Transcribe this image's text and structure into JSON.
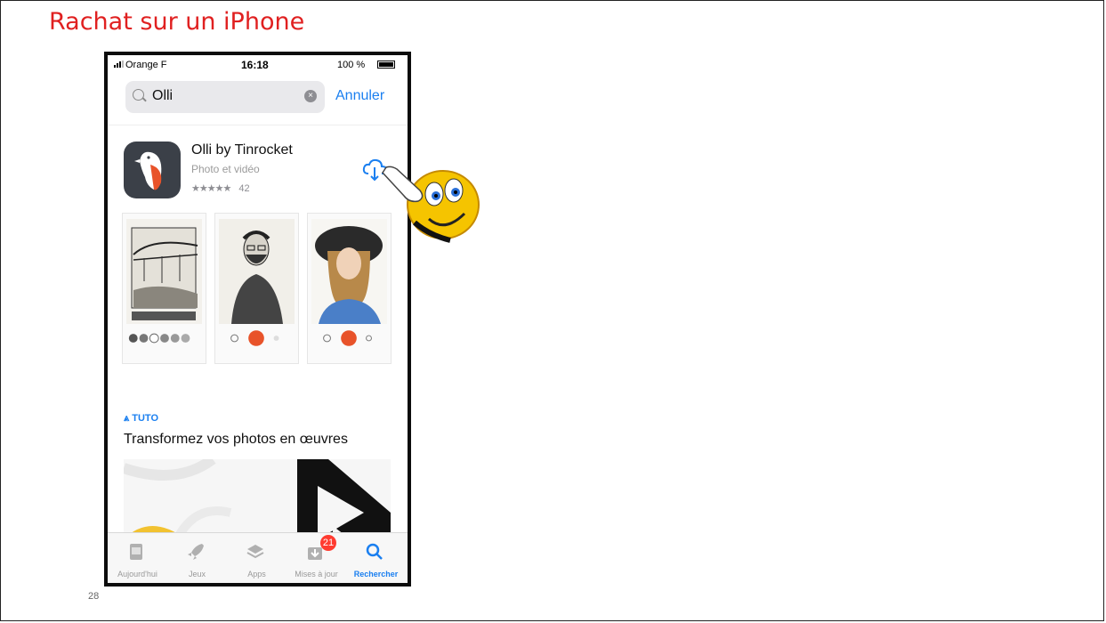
{
  "slide": {
    "title": "Rachat sur un iPhone",
    "number": "28"
  },
  "status_bar": {
    "carrier": "Orange F",
    "time": "16:18",
    "battery": "100 %"
  },
  "search": {
    "query": "Olli",
    "clear_symbol": "×",
    "cancel_label": "Annuler"
  },
  "app": {
    "name": "Olli by Tinrocket",
    "category": "Photo et vidéo",
    "stars": "★★★★★",
    "rating_count": "42",
    "download_icon": "cloud-download-icon"
  },
  "screenshots": [
    "sketch-bridge",
    "sketch-man-portrait",
    "sketch-woman-portrait"
  ],
  "article": {
    "label": "TUTO",
    "title": "Transformez vos photos en œuvres"
  },
  "tab_bar": {
    "items": [
      {
        "label": "Aujourd'hui",
        "icon": "today-icon"
      },
      {
        "label": "Jeux",
        "icon": "rocket-icon"
      },
      {
        "label": "Apps",
        "icon": "layers-icon"
      },
      {
        "label": "Mises à jour",
        "icon": "download-tray-icon",
        "badge": "21"
      },
      {
        "label": "Rechercher",
        "icon": "search-icon",
        "active": true
      }
    ]
  },
  "colors": {
    "title_red": "#e02020",
    "ios_blue": "#1a7ff0",
    "app_orange": "#e8532a",
    "badge_red": "#ff3b30"
  }
}
